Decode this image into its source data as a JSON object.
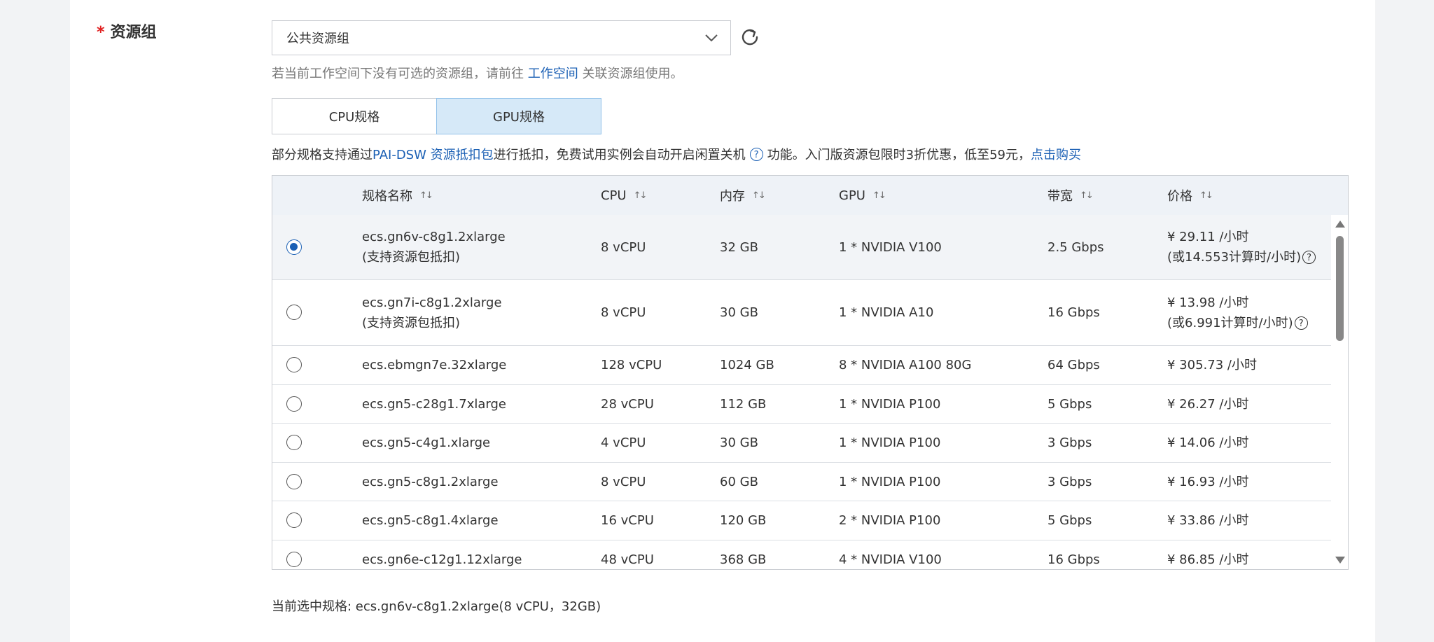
{
  "field": {
    "required_mark": "*",
    "label": "资源组"
  },
  "resource_select": {
    "value": "公共资源组"
  },
  "hint": {
    "prefix": "若当前工作空间下没有可选的资源组，请前往 ",
    "link": "工作空间",
    "suffix": " 关联资源组使用。"
  },
  "tabs": [
    {
      "label": "CPU规格",
      "active": false
    },
    {
      "label": "GPU规格",
      "active": true
    }
  ],
  "notice": {
    "prefix": "部分规格支持通过 ",
    "link1": "PAI-DSW 资源抵扣包",
    "middle": " 进行抵扣，免费试用实例会自动开启闲置关机",
    "after_icon": " 功能。入门版资源包限时3折优惠，低至59元，",
    "link2": "点击购买"
  },
  "table": {
    "columns": [
      "规格名称",
      "CPU",
      "内存",
      "GPU",
      "带宽",
      "价格"
    ],
    "rows": [
      {
        "name": "ecs.gn6v-c8g1.2xlarge",
        "note": "(支持资源包抵扣)",
        "cpu": "8 vCPU",
        "mem": "32 GB",
        "gpu": "1 * NVIDIA V100",
        "bw": "2.5 Gbps",
        "price": "¥ 29.11 /小时",
        "price2": "(或14.553计算时/小时)",
        "selected": true
      },
      {
        "name": "ecs.gn7i-c8g1.2xlarge",
        "note": "(支持资源包抵扣)",
        "cpu": "8 vCPU",
        "mem": "30 GB",
        "gpu": "1 * NVIDIA A10",
        "bw": "16 Gbps",
        "price": "¥ 13.98 /小时",
        "price2": "(或6.991计算时/小时)",
        "selected": false
      },
      {
        "name": "ecs.ebmgn7e.32xlarge",
        "note": "",
        "cpu": "128 vCPU",
        "mem": "1024 GB",
        "gpu": "8 * NVIDIA A100 80G",
        "bw": "64 Gbps",
        "price": "¥ 305.73 /小时",
        "price2": "",
        "selected": false
      },
      {
        "name": "ecs.gn5-c28g1.7xlarge",
        "note": "",
        "cpu": "28 vCPU",
        "mem": "112 GB",
        "gpu": "1 * NVIDIA P100",
        "bw": "5 Gbps",
        "price": "¥ 26.27 /小时",
        "price2": "",
        "selected": false
      },
      {
        "name": "ecs.gn5-c4g1.xlarge",
        "note": "",
        "cpu": "4 vCPU",
        "mem": "30 GB",
        "gpu": "1 * NVIDIA P100",
        "bw": "3 Gbps",
        "price": "¥ 14.06 /小时",
        "price2": "",
        "selected": false
      },
      {
        "name": "ecs.gn5-c8g1.2xlarge",
        "note": "",
        "cpu": "8 vCPU",
        "mem": "60 GB",
        "gpu": "1 * NVIDIA P100",
        "bw": "3 Gbps",
        "price": "¥ 16.93 /小时",
        "price2": "",
        "selected": false
      },
      {
        "name": "ecs.gn5-c8g1.4xlarge",
        "note": "",
        "cpu": "16 vCPU",
        "mem": "120 GB",
        "gpu": "2 * NVIDIA P100",
        "bw": "5 Gbps",
        "price": "¥ 33.86 /小时",
        "price2": "",
        "selected": false
      },
      {
        "name": "ecs.gn6e-c12g1.12xlarge",
        "note": "",
        "cpu": "48 vCPU",
        "mem": "368 GB",
        "gpu": "4 * NVIDIA V100",
        "bw": "16 Gbps",
        "price": "¥ 86.85 /小时",
        "price2": "",
        "selected": false
      }
    ]
  },
  "current_selection": "当前选中规格: ecs.gn6v-c8g1.2xlarge(8 vCPU，32GB)",
  "icons": {
    "dropdown": "chevron-down-icon",
    "refresh": "refresh-icon",
    "help": "question-circle-icon",
    "sort": "sort-icon"
  },
  "colors": {
    "link": "#1a5fb4",
    "active_tab_bg": "#d6e9f8",
    "header_bg": "#eef2f7",
    "required": "#e02020"
  }
}
